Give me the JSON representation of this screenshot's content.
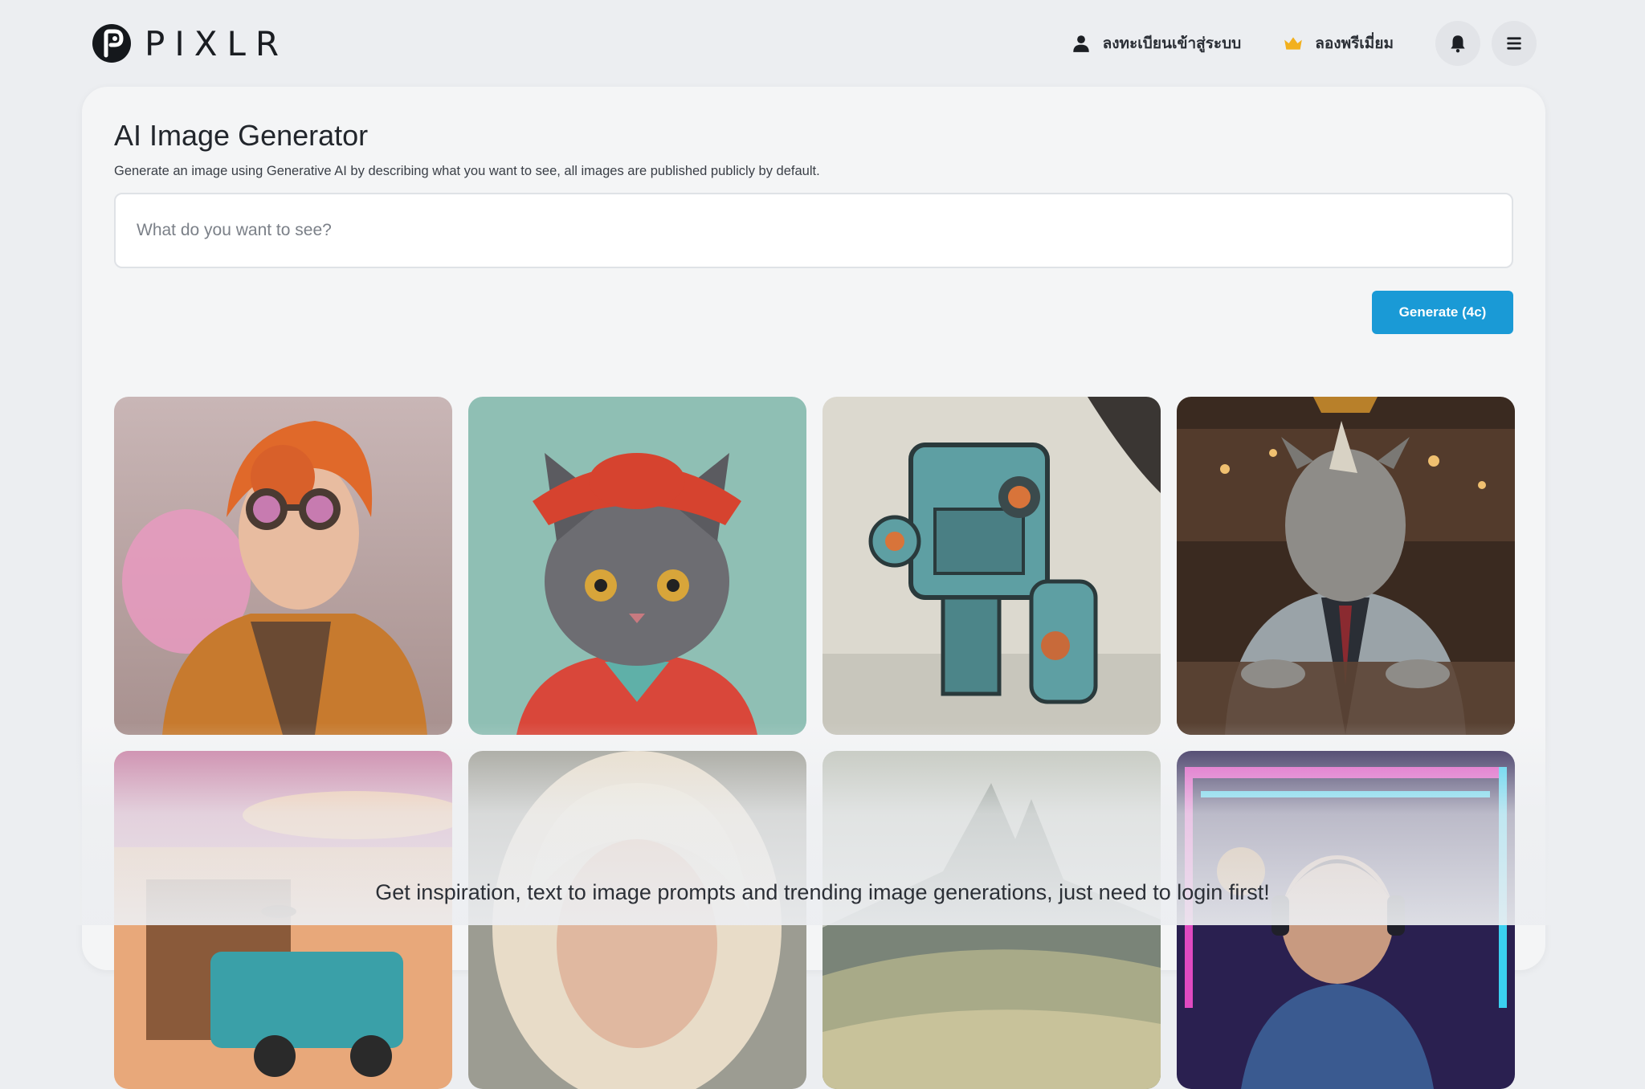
{
  "brand": {
    "name": "PIXLR",
    "logo_icon": "pixlr-logo-icon"
  },
  "nav": {
    "login_label": "ลงทะเบียนเข้าสู่ระบบ",
    "login_icon": "user-icon",
    "premium_label": "ลองพรีเมี่ยม",
    "premium_icon": "crown-icon",
    "bell_icon": "bell-icon",
    "menu_icon": "hamburger-menu-icon"
  },
  "main": {
    "title": "AI Image Generator",
    "subtitle": "Generate an image using Generative AI by describing what you want to see, all images are published publicly by default.",
    "prompt_placeholder": "What do you want to see?",
    "prompt_value": "",
    "generate_label": "Generate (4c)"
  },
  "gallery": {
    "images": [
      "red-haired-steampunk-goggles-portrait",
      "cat-in-red-hat-and-kimono",
      "blue-robot-mech-illustration",
      "rhino-in-suit-at-bar",
      "retro-truck-sunset-scene",
      "blonde-woman-portrait",
      "misty-mountain-landscape",
      "neon-gamer-with-headphones"
    ]
  },
  "cta": "Get inspiration, text to image prompts and trending image generations, just need to login first!",
  "colors": {
    "accent": "#1a9ad6",
    "crown": "#f2b01e",
    "background": "#eceef1",
    "card": "#f4f5f6"
  }
}
